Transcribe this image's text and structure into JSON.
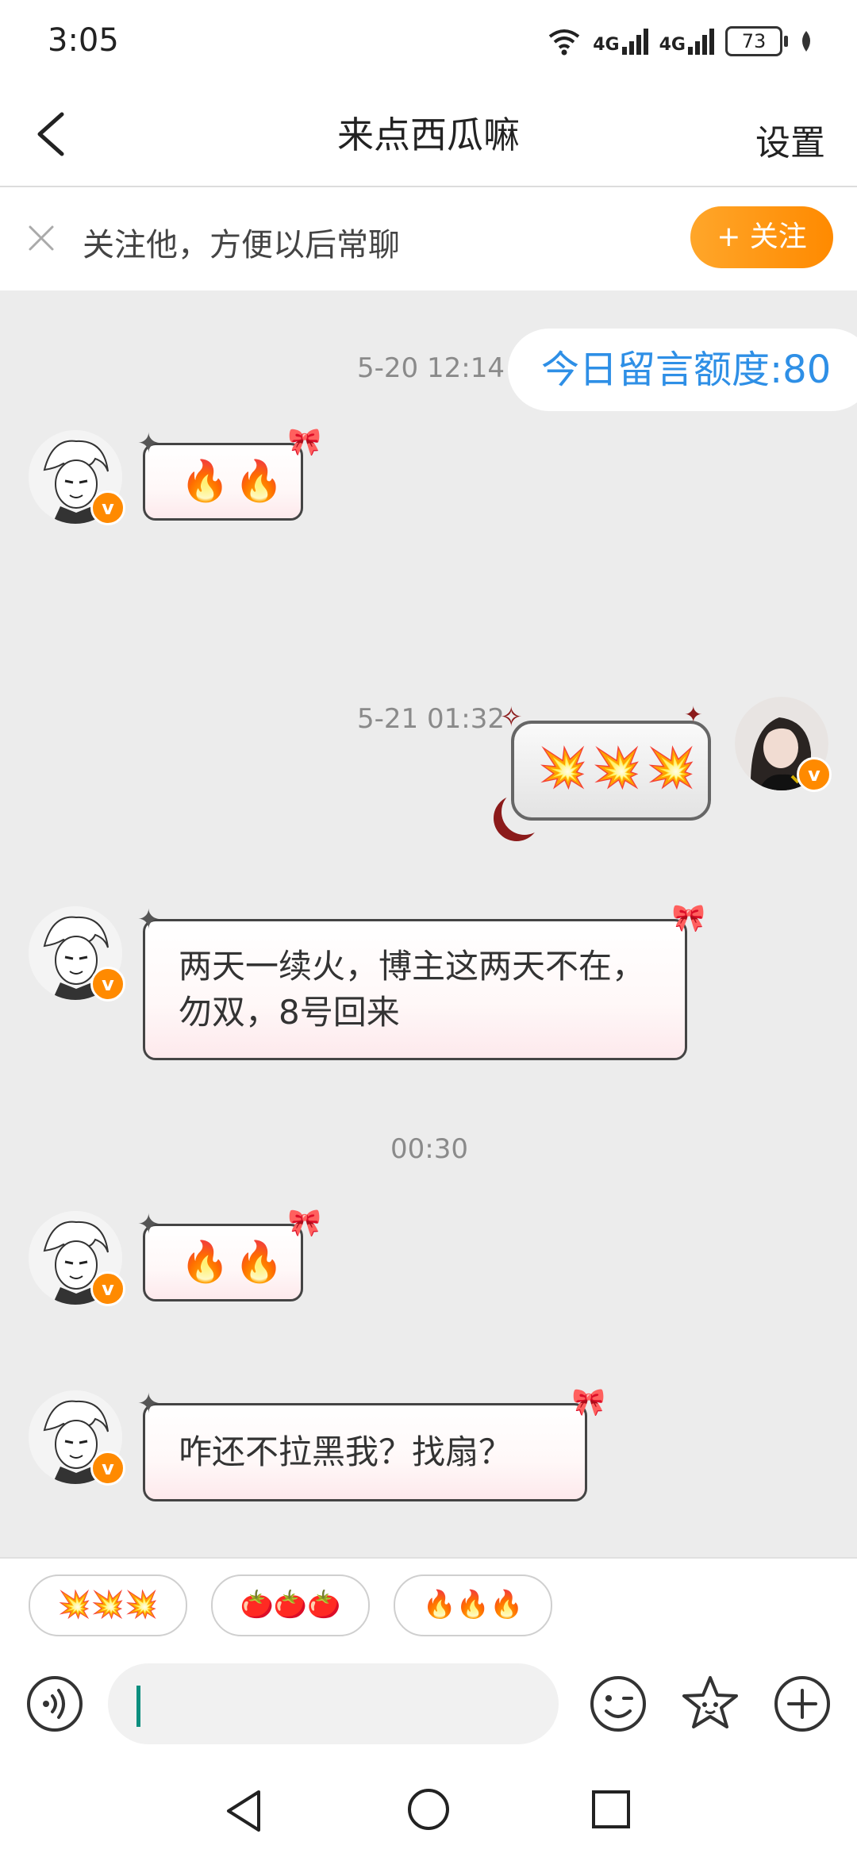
{
  "status": {
    "time": "3:05",
    "signal1": "4G",
    "signal2": "4G",
    "battery": "73"
  },
  "header": {
    "title": "来点西瓜嘛",
    "settings_label": "设置"
  },
  "follow_banner": {
    "text": "关注他，方便以后常聊",
    "button_label": "+ 关注"
  },
  "messages": {
    "ts1": "5-20 12:14",
    "quota": "今日留言额度:80",
    "m1": "🔥🔥",
    "ts2": "5-21 01:32",
    "m2": "💥💥💥",
    "m3": "两天一续火，博主这两天不在，勿双，8号回来",
    "ts3": "00:30",
    "m4": "🔥🔥",
    "m5": "咋还不拉黑我？找扇？"
  },
  "quick_replies": [
    "💥💥💥",
    "🍅🍅🍅",
    "🔥🔥🔥"
  ],
  "input": {
    "value": ""
  }
}
